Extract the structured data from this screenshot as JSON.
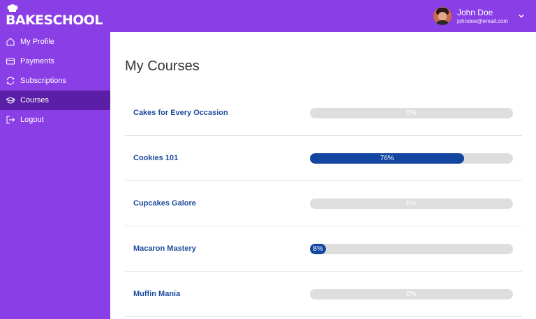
{
  "brand": {
    "name": "BAKESCHOOL"
  },
  "user": {
    "name": "John Doe",
    "email": "johndoe@email.com"
  },
  "sidebar": {
    "items": [
      {
        "label": "My Profile",
        "icon": "home-icon",
        "active": false
      },
      {
        "label": "Payments",
        "icon": "credit-card-icon",
        "active": false
      },
      {
        "label": "Subscriptions",
        "icon": "refresh-icon",
        "active": false
      },
      {
        "label": "Courses",
        "icon": "graduation-cap-icon",
        "active": true
      },
      {
        "label": "Logout",
        "icon": "logout-icon",
        "active": false
      }
    ]
  },
  "main": {
    "title": "My Courses",
    "courses": [
      {
        "name": "Cakes for Every Occasion",
        "progress": 0,
        "progress_label": "0%"
      },
      {
        "name": "Cookies 101",
        "progress": 76,
        "progress_label": "76%"
      },
      {
        "name": "Cupcakes Galore",
        "progress": 0,
        "progress_label": "0%"
      },
      {
        "name": "Macaron Mastery",
        "progress": 8,
        "progress_label": "8%"
      },
      {
        "name": "Muffin Mania",
        "progress": 0,
        "progress_label": "0%"
      }
    ]
  },
  "colors": {
    "brand_purple": "#8a3ee6",
    "active_nav": "#5a1fa6",
    "progress_fill": "#1246a1",
    "progress_track": "#dedede",
    "course_link": "#1c4a9c"
  }
}
